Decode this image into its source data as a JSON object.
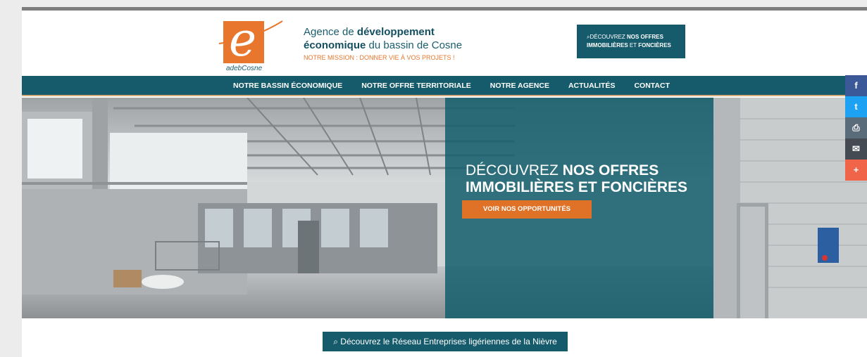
{
  "header": {
    "logo_text": "adebCosne",
    "tagline": {
      "line1_pre": "Agence de ",
      "line1_bold": "développement",
      "line2_bold": "économique",
      "line2_post": " du bassin de Cosne",
      "mission": "NOTRE MISSION : DONNER VIE À VOS PROJETS !"
    },
    "cta": {
      "icon": "⌕",
      "pre": "DÉCOUVREZ ",
      "bold1": "NOS OFFRES",
      "bold2": "IMMOBILIÈRES",
      "mid": " ET ",
      "bold3": "FONCIÈRES"
    }
  },
  "nav": {
    "items": [
      "NOTRE BASSIN ÉCONOMIQUE",
      "NOTRE OFFRE TERRITORIALE",
      "NOTRE AGENCE",
      "ACTUALITÉS",
      "CONTACT"
    ]
  },
  "hero": {
    "title_pre": "DÉCOUVREZ ",
    "title_bold1": "NOS OFFRES",
    "title_bold2": "IMMOBILIÈRES ET FONCIÈRES",
    "button": "VOIR NOS OPPORTUNITÉS"
  },
  "social": [
    {
      "name": "facebook",
      "glyph": "f",
      "color": "#3b5998"
    },
    {
      "name": "twitter",
      "glyph": "t",
      "color": "#1da1f2"
    },
    {
      "name": "print",
      "glyph": "⎙",
      "color": "#5a6b7a"
    },
    {
      "name": "email",
      "glyph": "✉",
      "color": "#444b52"
    },
    {
      "name": "more",
      "glyph": "+",
      "color": "#f0654a"
    }
  ],
  "bottom_cta": {
    "icon": "⌕",
    "label": "Découvrez le Réseau Entreprises ligériennes de la Nièvre"
  }
}
